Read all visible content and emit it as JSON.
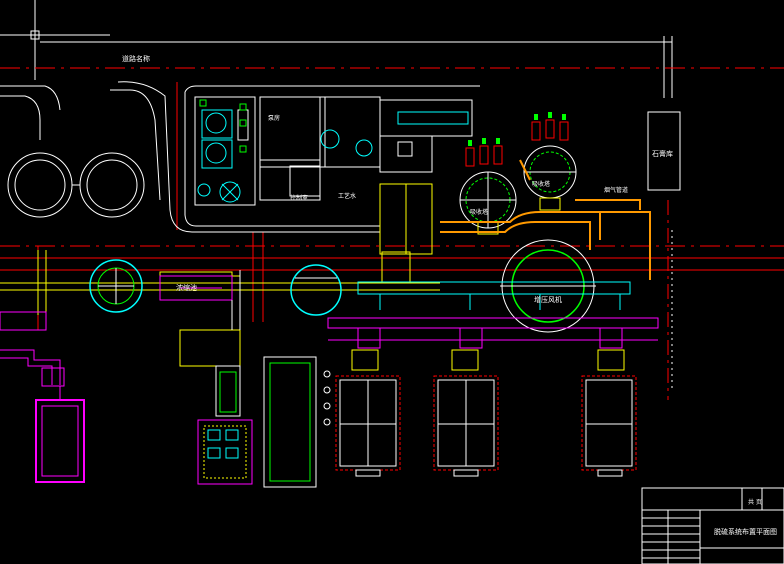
{
  "drawing": {
    "title_block": {
      "drawing_title": "脱硫系统布置平面图",
      "sheet_marker": "共  页"
    },
    "labels": {
      "top_road": "道路名称",
      "flue_duct_right": "烟气管道",
      "gypsum_building": "石膏库",
      "absorber_left": "吸收塔",
      "absorber_right": "吸收塔",
      "booster_fan": "增压风机",
      "thickener": "浓缩池",
      "process_water": "工艺水",
      "pump_house": "泵房",
      "control_room": "控制室"
    },
    "colors": {
      "background": "#000000",
      "white_lines": "#ffffff",
      "red_axis": "#ff0000",
      "yellow_duct": "#ffff00",
      "magenta_equipment": "#ff00ff",
      "cyan_circles": "#00ffff",
      "green_circle": "#00ff00",
      "orange_ducts": "#ff9900"
    }
  }
}
